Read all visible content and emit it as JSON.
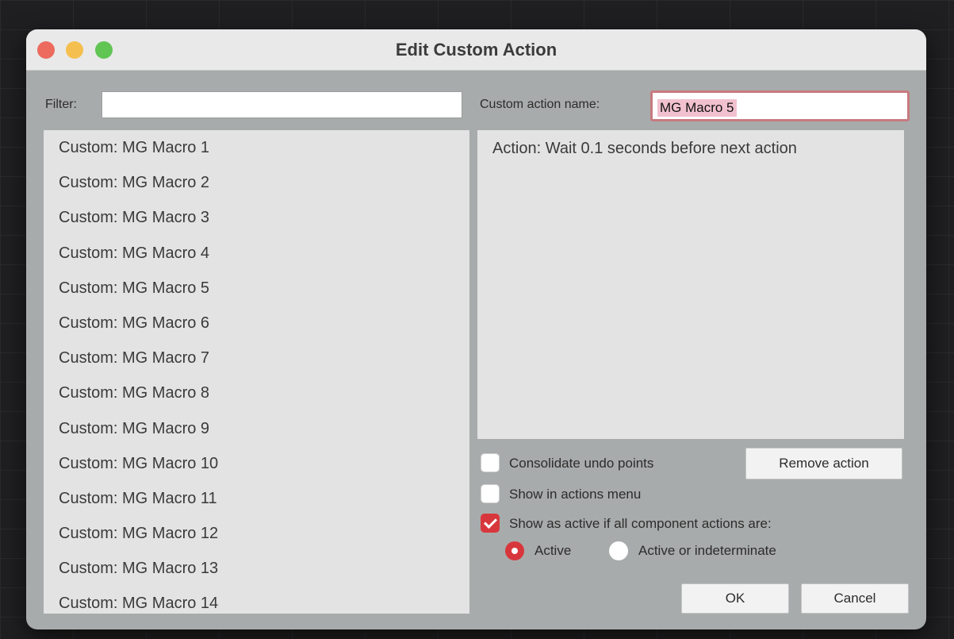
{
  "window": {
    "title": "Edit Custom Action"
  },
  "filter": {
    "label": "Filter:",
    "value": ""
  },
  "name": {
    "label": "Custom action name:",
    "value": "MG Macro 5"
  },
  "list": {
    "items": [
      "Custom: MG Macro 1",
      "Custom: MG Macro 2",
      "Custom: MG Macro 3",
      "Custom: MG Macro 4",
      "Custom: MG Macro 5",
      "Custom: MG Macro 6",
      "Custom: MG Macro 7",
      "Custom: MG Macro 8",
      "Custom: MG Macro 9",
      "Custom: MG Macro 10",
      "Custom: MG Macro 11",
      "Custom: MG Macro 12",
      "Custom: MG Macro 13",
      "Custom: MG Macro 14"
    ]
  },
  "actions": {
    "items": [
      "Action: Wait 0.1 seconds before next action"
    ]
  },
  "options": {
    "consolidate": {
      "label": "Consolidate undo points",
      "checked": false
    },
    "show_in_menu": {
      "label": "Show in actions menu",
      "checked": false
    },
    "show_active": {
      "label": "Show as active if all component actions are:",
      "checked": true
    },
    "radio_active": {
      "label": "Active",
      "selected": true
    },
    "radio_indeterminate": {
      "label": "Active or indeterminate",
      "selected": false
    }
  },
  "buttons": {
    "remove": "Remove action",
    "ok": "OK",
    "cancel": "Cancel"
  },
  "colors": {
    "accent": "#d7373c",
    "dialog_bg": "#a8abab",
    "panel_bg": "#e3e3e3",
    "name_focus_border": "#c77a80",
    "selection": "#f1c1cf"
  }
}
